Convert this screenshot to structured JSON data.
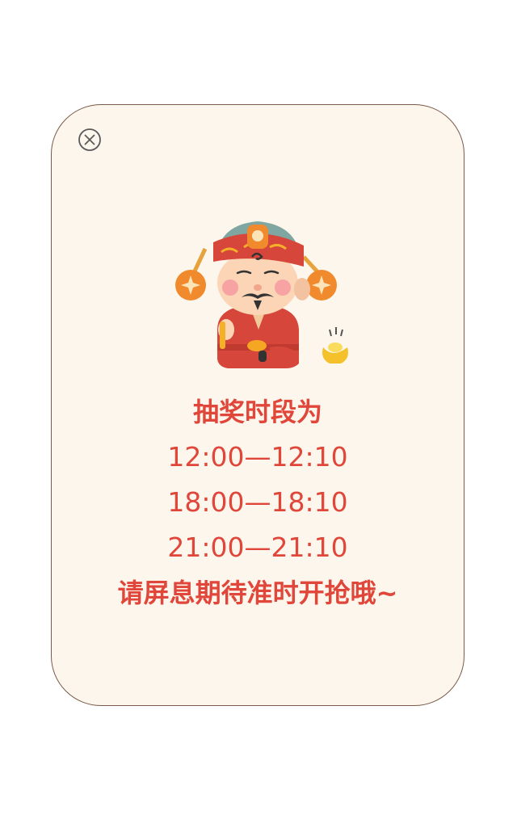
{
  "popup": {
    "close_icon": "close-circle-icon",
    "mascot": "god-of-wealth-illustration",
    "heading": "抽奖时段为",
    "time_slots": [
      "12:00—12:10",
      "18:00—18:10",
      "21:00—21:10"
    ],
    "tip": "请屏息期待准时开抢哦~",
    "colors": {
      "background": "#fdf6ec",
      "border": "#7a5a4a",
      "text": "#e0463a"
    }
  }
}
